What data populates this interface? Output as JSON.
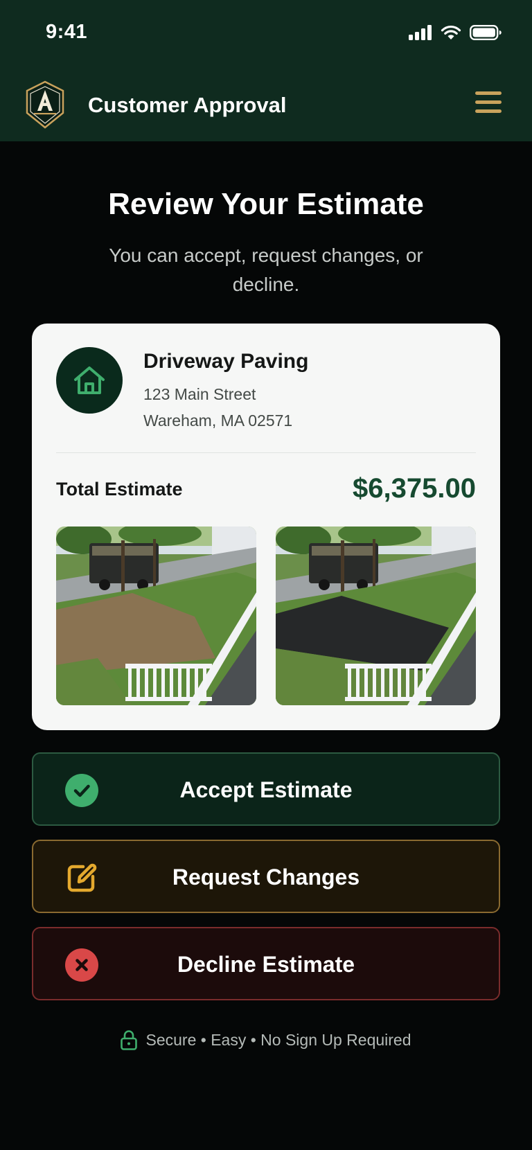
{
  "status_bar": {
    "time": "9:41"
  },
  "header": {
    "title": "Customer Approval",
    "logo_icon": "shield-logo-icon",
    "menu_icon": "hamburger-menu-icon"
  },
  "intro": {
    "title": "Review Your Estimate",
    "subtitle": "You can accept, request changes, or decline."
  },
  "estimate": {
    "icon": "house-icon",
    "job_title": "Driveway Paving",
    "address_line1": "123 Main Street",
    "address_line2": "Wareham, MA 02571",
    "total_label": "Total Estimate",
    "total_amount": "$6,375.00",
    "photos": [
      "before-photo",
      "after-photo"
    ]
  },
  "actions": {
    "accept": {
      "label": "Accept Estimate",
      "icon": "check-circle-icon",
      "color": "#3fae6d"
    },
    "request": {
      "label": "Request Changes",
      "icon": "edit-icon",
      "color": "#e4a92e"
    },
    "decline": {
      "label": "Decline Estimate",
      "icon": "close-circle-icon",
      "color": "#d94848"
    }
  },
  "footer": {
    "text": "Secure • Easy • No Sign Up Required",
    "icon": "lock-icon"
  },
  "colors": {
    "header_bg": "#0f2b1f",
    "brand_green": "#164a30",
    "gold": "#c9a25c"
  }
}
